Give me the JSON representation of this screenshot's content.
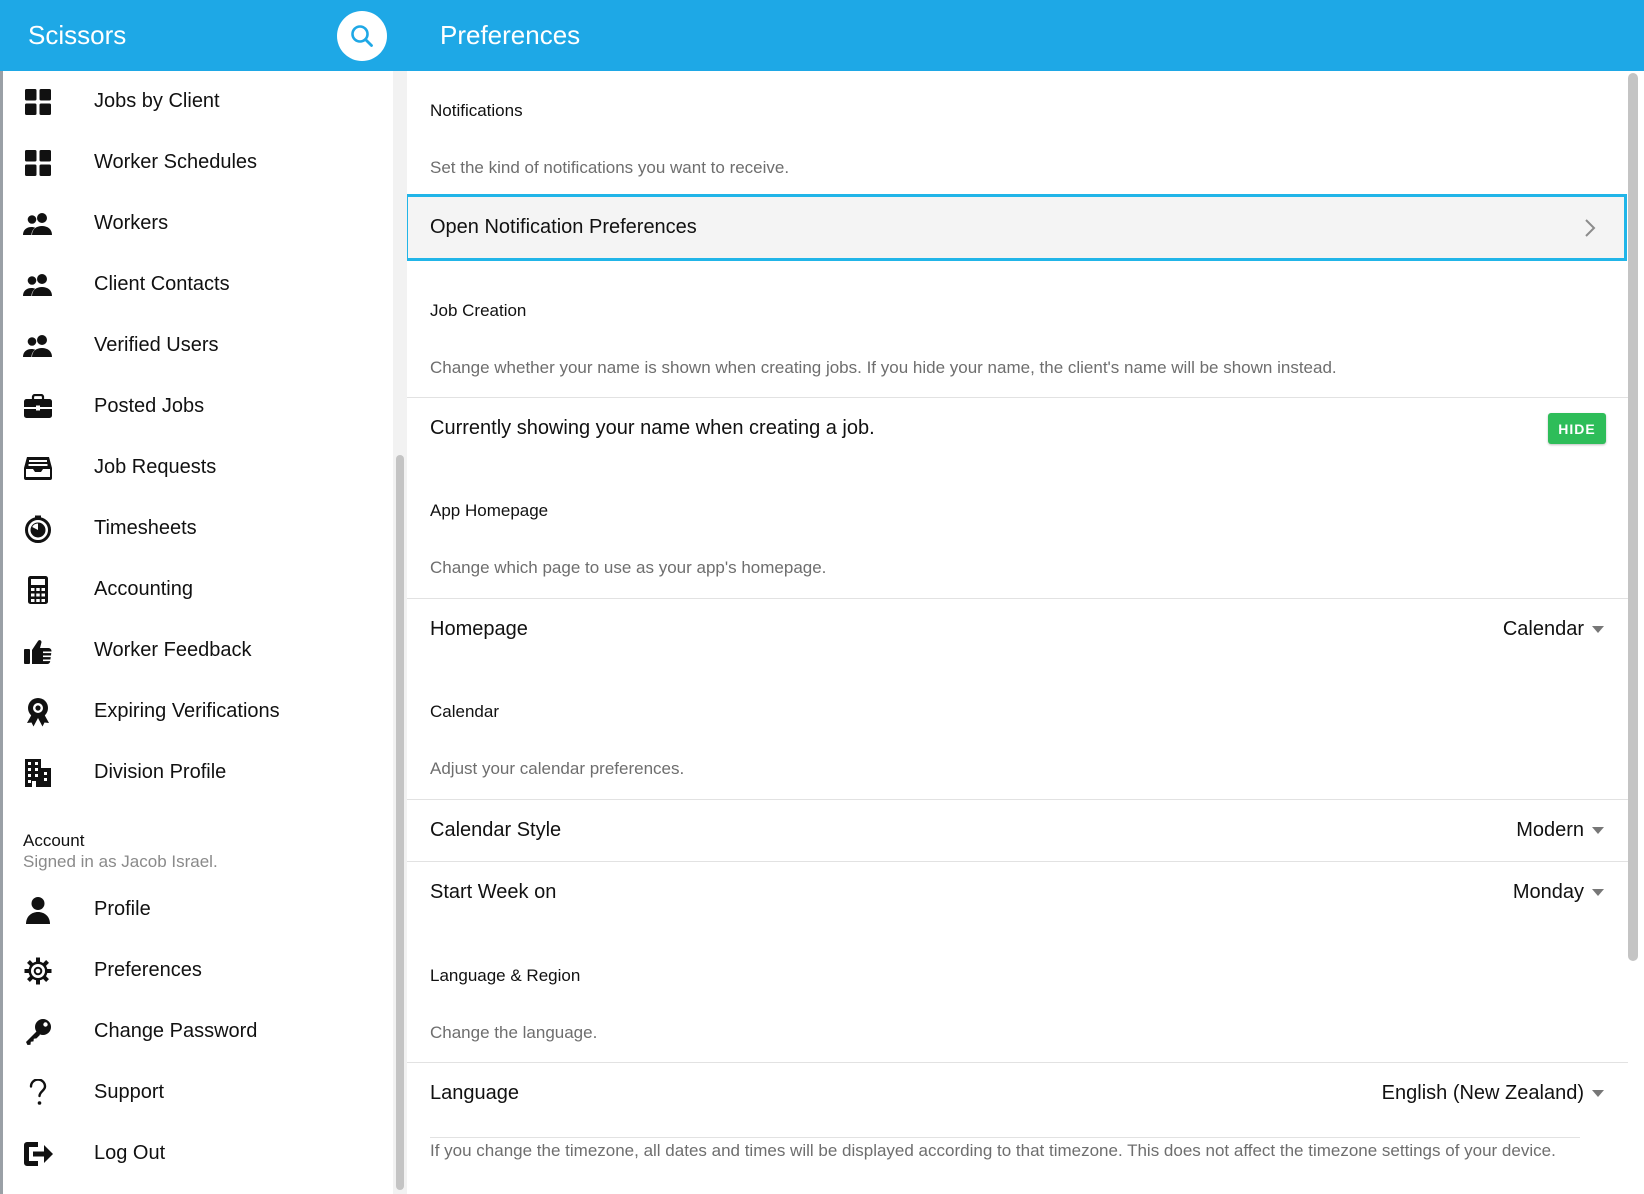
{
  "app": {
    "title": "Scissors"
  },
  "header": {
    "page_title": "Preferences"
  },
  "sidebar": {
    "items": [
      {
        "label": "Jobs by Client",
        "icon": "grid-icon"
      },
      {
        "label": "Worker Schedules",
        "icon": "grid-icon"
      },
      {
        "label": "Workers",
        "icon": "people-icon"
      },
      {
        "label": "Client Contacts",
        "icon": "people-icon"
      },
      {
        "label": "Verified Users",
        "icon": "people-icon"
      },
      {
        "label": "Posted Jobs",
        "icon": "briefcase-icon"
      },
      {
        "label": "Job Requests",
        "icon": "inbox-icon"
      },
      {
        "label": "Timesheets",
        "icon": "stopwatch-icon"
      },
      {
        "label": "Accounting",
        "icon": "calculator-icon"
      },
      {
        "label": "Worker Feedback",
        "icon": "thumbs-up-icon"
      },
      {
        "label": "Expiring Verifications",
        "icon": "award-icon"
      },
      {
        "label": "Division Profile",
        "icon": "building-icon"
      }
    ],
    "account": {
      "heading": "Account",
      "signed_in": "Signed in as Jacob Israel.",
      "items": [
        {
          "label": "Profile",
          "icon": "person-icon"
        },
        {
          "label": "Preferences",
          "icon": "gear-icon"
        },
        {
          "label": "Change Password",
          "icon": "key-icon"
        },
        {
          "label": "Support",
          "icon": "question-icon"
        },
        {
          "label": "Log Out",
          "icon": "logout-icon"
        }
      ]
    }
  },
  "main": {
    "notifications": {
      "title": "Notifications",
      "description": "Set the kind of notifications you want to receive.",
      "open_label": "Open Notification Preferences"
    },
    "job_creation": {
      "title": "Job Creation",
      "description": "Change whether your name is shown when creating jobs. If you hide your name, the client's name will be shown instead.",
      "status_label": "Currently showing your name when creating a job.",
      "button_label": "HIDE"
    },
    "app_homepage": {
      "title": "App Homepage",
      "description": "Change which page to use as your app's homepage.",
      "homepage_label": "Homepage",
      "homepage_value": "Calendar"
    },
    "calendar": {
      "title": "Calendar",
      "description": "Adjust your calendar preferences.",
      "style_label": "Calendar Style",
      "style_value": "Modern",
      "week_label": "Start Week on",
      "week_value": "Monday"
    },
    "language_region": {
      "title": "Language & Region",
      "description": "Change the language.",
      "language_label": "Language",
      "language_value": "English (New Zealand)",
      "timezone_note": "If you change the timezone, all dates and times will be displayed according to that timezone. This does not affect the timezone settings of your device."
    }
  },
  "colors": {
    "accent": "#1ea8e6",
    "focus_border": "#21b5e8",
    "hide_button": "#2ebd59"
  }
}
